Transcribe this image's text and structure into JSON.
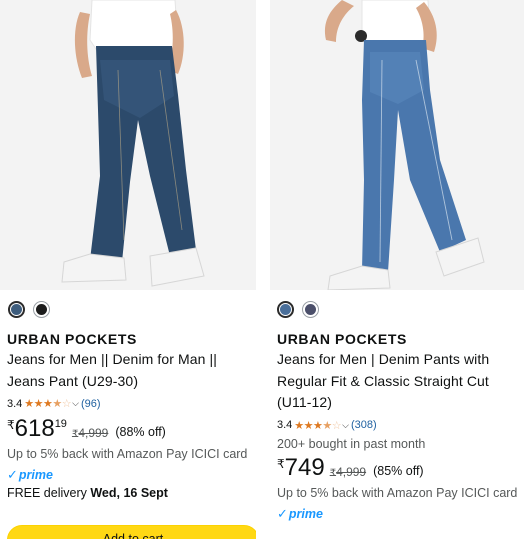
{
  "products": [
    {
      "brand": "URBAN POCKETS",
      "title": "Jeans for Men || Denim for Man || Jeans Pant (U29-30)",
      "rating": "3.4",
      "reviews": "(96)",
      "price_symbol": "₹",
      "price_whole": "618",
      "price_fraction": "19",
      "mrp_symbol": "₹",
      "mrp": "4,999",
      "discount": "(88% off)",
      "cashback": "Up to 5% back with Amazon Pay ICICI card",
      "prime": "prime",
      "delivery_prefix": "FREE delivery ",
      "delivery_date": "Wed, 16 Sept",
      "add_to_cart": "Add to cart",
      "swatches": [
        {
          "color": "#3e5d7d",
          "selected": true
        },
        {
          "color": "#1c1c1c",
          "selected": false
        }
      ]
    },
    {
      "brand": "URBAN POCKETS",
      "title": "Jeans for Men | Denim Pants with Regular Fit & Classic Straight Cut (U11-12)",
      "rating": "3.4",
      "reviews": "(308)",
      "bought": "200+ bought in past month",
      "price_symbol": "₹",
      "price_whole": "749",
      "mrp_symbol": "₹",
      "mrp": "4,999",
      "discount": "(85% off)",
      "cashback": "Up to 5% back with Amazon Pay ICICI card",
      "prime": "prime",
      "swatches": [
        {
          "color": "#4a6f9a",
          "selected": true
        },
        {
          "color": "#4b4f6a",
          "selected": false
        }
      ]
    }
  ],
  "colors": {
    "star": "#de7921",
    "link": "#2162a1",
    "prime": "#1a98ff",
    "button": "#ffd814"
  }
}
